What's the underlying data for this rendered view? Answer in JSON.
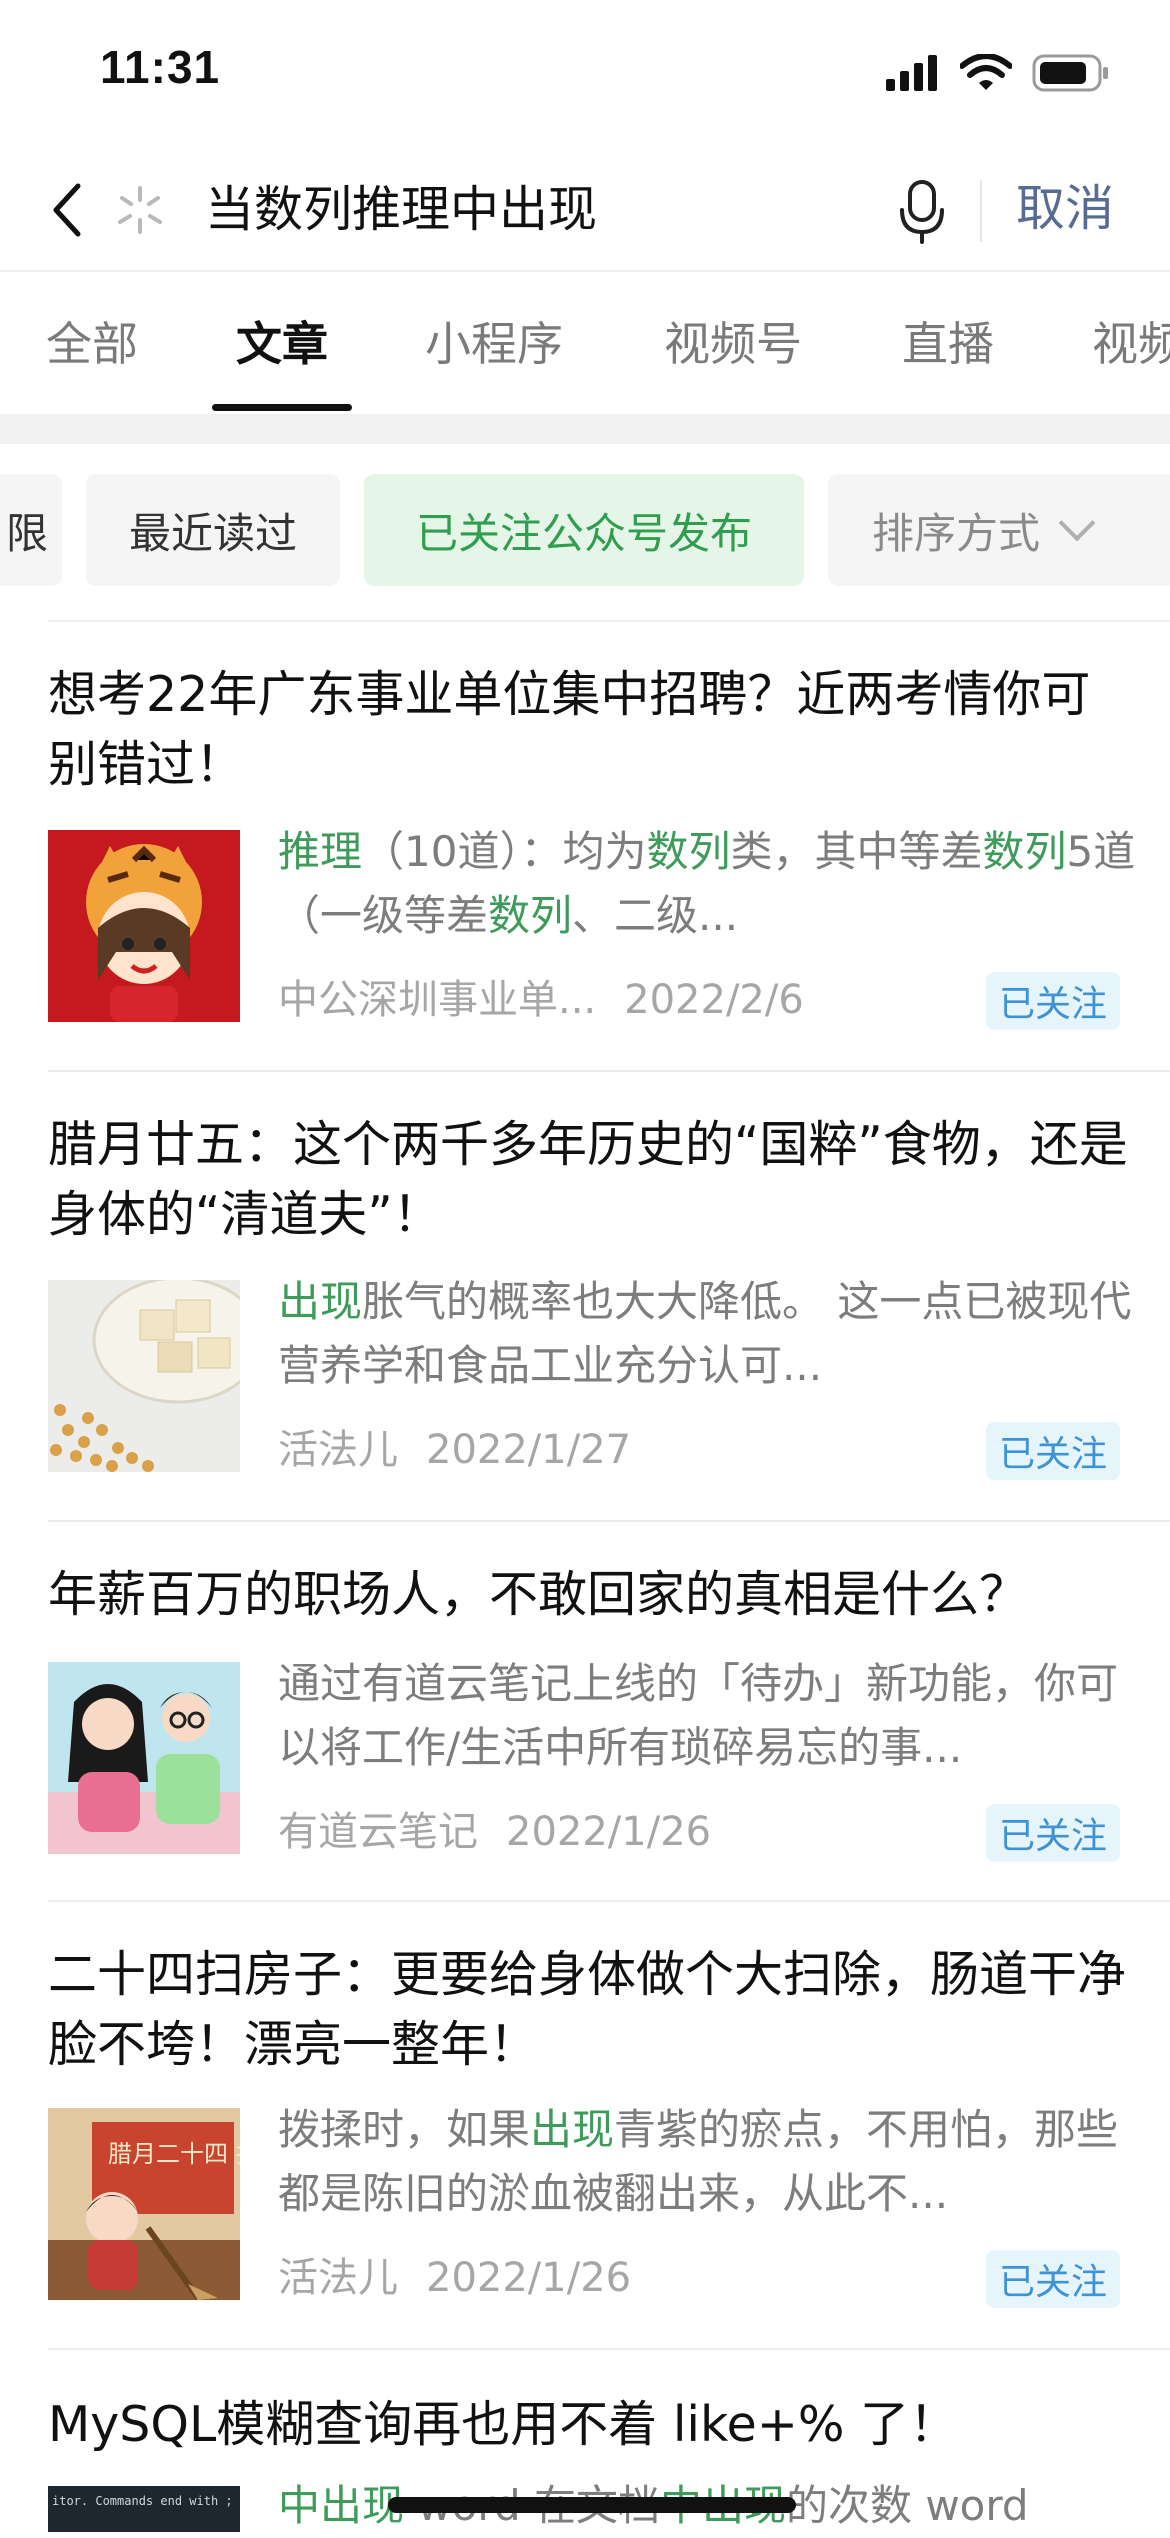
{
  "status_bar": {
    "time": "11:31"
  },
  "search": {
    "query": "当数列推理中出现",
    "cancel_label": "取消"
  },
  "tabs": [
    {
      "label": "全部",
      "active": false
    },
    {
      "label": "文章",
      "active": true
    },
    {
      "label": "小程序",
      "active": false
    },
    {
      "label": "视频号",
      "active": false
    },
    {
      "label": "直播",
      "active": false
    },
    {
      "label": "视频",
      "active": false
    }
  ],
  "filters": [
    {
      "label": "限"
    },
    {
      "label": "最近读过"
    },
    {
      "label": "已关注公众号发布",
      "active": true
    },
    {
      "label": "排序方式"
    }
  ],
  "articles": [
    {
      "title": "想考22年广东事业单位集中招聘？近两考情你可别错过！",
      "snippet": [
        {
          "text": "推理",
          "hl": true
        },
        {
          "text": "（10道）：均为"
        },
        {
          "text": "数列",
          "hl": true
        },
        {
          "text": "类，其中等差"
        },
        {
          "text": "数列",
          "hl": true
        },
        {
          "text": "5道（一级等差"
        },
        {
          "text": "数列",
          "hl": true
        },
        {
          "text": "、二级..."
        }
      ],
      "source": "中公深圳事业单...",
      "date": "2022/2/6",
      "badge": "已关注",
      "thumb_icon": "tiger-girl-cartoon-thumbnail"
    },
    {
      "title": "腊月廿五：这个两千多年历史的“国粹”食物，还是身体的“清道夫”！",
      "snippet": [
        {
          "text": "出现",
          "hl": true
        },
        {
          "text": "胀气的概率也大大降低。 这一点已被现代营养学和食品工业充分认可..."
        }
      ],
      "source": "活法儿",
      "date": "2022/1/27",
      "badge": "已关注",
      "thumb_icon": "tofu-soybeans-thumbnail"
    },
    {
      "title": "年薪百万的职场人，不敢回家的真相是什么？",
      "snippet": [
        {
          "text": "通过有道云笔记上线的「待办」新功能，你可以将工作/生活中所有琐碎易忘的事..."
        }
      ],
      "source": "有道云笔记",
      "date": "2022/1/26",
      "badge": "已关注",
      "thumb_icon": "two-women-illustration-thumbnail"
    },
    {
      "title": "二十四扫房子：更要给身体做个大扫除，肠道干净脸不垮！漂亮一整年！",
      "snippet": [
        {
          "text": "拨揉时，如果"
        },
        {
          "text": "出现",
          "hl": true
        },
        {
          "text": "青紫的瘀点，不用怕，那些都是陈旧的淤血被翻出来，从此不..."
        }
      ],
      "source": "活法儿",
      "date": "2022/1/26",
      "badge": "已关注",
      "thumb_icon": "sweeping-house-illustration-thumbnail",
      "thumb_text": "腊月二十四 扫房子"
    },
    {
      "title": "MySQL模糊查询再也用不着 like+% 了！",
      "snippet": [
        {
          "text": "中出现",
          "hl": true
        },
        {
          "text": " word 在文档"
        },
        {
          "text": "中出现",
          "hl": true
        },
        {
          "text": "的次数 word"
        }
      ],
      "thumb_icon": "code-terminal-thumbnail",
      "thumb_text": "itor.  Commands end with ; or \\g."
    }
  ],
  "colors": {
    "highlight": "#3e9b5a",
    "link_blue": "#576b95",
    "follow_badge_bg": "#e6f4fc",
    "follow_badge_text": "#3d93d6",
    "active_chip_bg": "#e5f5e8"
  }
}
